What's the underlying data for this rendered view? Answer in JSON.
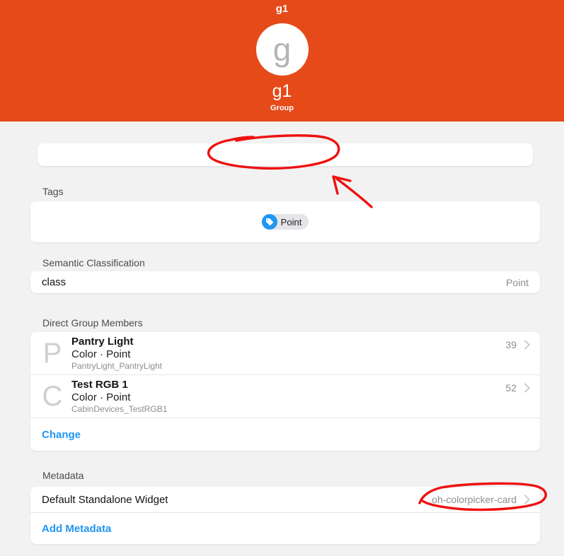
{
  "header": {
    "nav_title": "g1",
    "avatar_letter": "g",
    "item_name": "g1",
    "item_type": "Group"
  },
  "state_bar": {
    "value": ""
  },
  "tags": {
    "title": "Tags",
    "chip": {
      "label": "Point",
      "icon": "tag-icon"
    }
  },
  "semantic": {
    "title": "Semantic Classification",
    "class_label": "class",
    "class_value": "Point"
  },
  "members": {
    "title": "Direct Group Members",
    "items": [
      {
        "initial": "P",
        "title": "Pantry Light",
        "subtitle": "Color · Point",
        "footer": "PantryLight_PantryLight",
        "badge": "39"
      },
      {
        "initial": "C",
        "title": "Test RGB 1",
        "subtitle": "Color · Point",
        "footer": "CabinDevices_TestRGB1",
        "badge": "52"
      }
    ],
    "change_label": "Change"
  },
  "metadata": {
    "title": "Metadata",
    "row_label": "Default Standalone Widget",
    "row_value": "oh-colorpicker-card",
    "add_label": "Add Metadata"
  },
  "colors": {
    "header_bg": "#e64a19",
    "link_blue": "#2196f3",
    "chip_icon_bg": "#2196f3",
    "annotation_red": "#ee1111",
    "page_bg": "#f2f2f2"
  }
}
